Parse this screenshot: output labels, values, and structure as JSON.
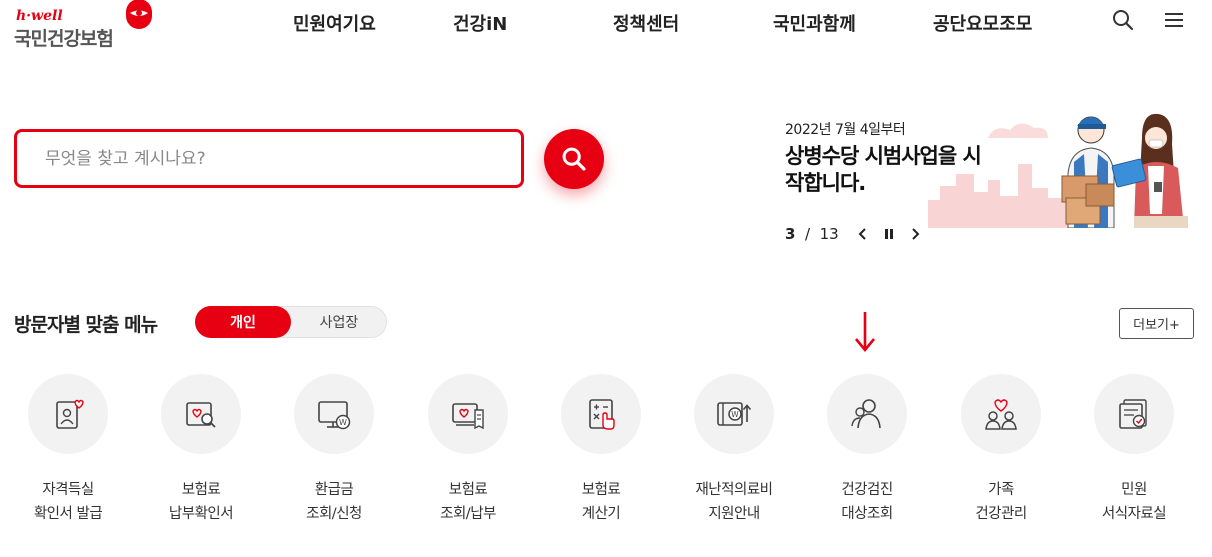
{
  "logo": {
    "tagline": "h·well",
    "name": "국민건강보험"
  },
  "gnb": [
    "민원여기요",
    "건강iN",
    "정책센터",
    "국민과함께",
    "공단요모조모"
  ],
  "search": {
    "placeholder": "무엇을 찾고 계시나요?"
  },
  "banner": {
    "date": "2022년 7월 4일부터",
    "title": "상병수당 시범사업을 시작합니다.",
    "current": "3",
    "total": "13"
  },
  "visitor_menu": {
    "title": "방문자별 맞춤 메뉴",
    "toggle": [
      "개인",
      "사업장"
    ],
    "more": "더보기+",
    "items": [
      {
        "line1": "자격득실",
        "line2": "확인서 발급",
        "icon": "qualification-certificate-icon"
      },
      {
        "line1": "보험료",
        "line2": "납부확인서",
        "icon": "payment-confirmation-icon"
      },
      {
        "line1": "환급금",
        "line2": "조회/신청",
        "icon": "refund-icon"
      },
      {
        "line1": "보험료",
        "line2": "조회/납부",
        "icon": "premium-payment-icon"
      },
      {
        "line1": "보험료",
        "line2": "계산기",
        "icon": "calculator-icon"
      },
      {
        "line1": "재난적의료비",
        "line2": "지원안내",
        "icon": "medical-support-icon"
      },
      {
        "line1": "건강검진",
        "line2": "대상조회",
        "icon": "checkup-target-icon"
      },
      {
        "line1": "가족",
        "line2": "건강관리",
        "icon": "family-health-icon"
      },
      {
        "line1": "민원",
        "line2": "서식자료실",
        "icon": "forms-library-icon"
      }
    ]
  },
  "colors": {
    "accent": "#e60012",
    "circle_bg": "#f2f2f2",
    "text": "#222222"
  }
}
